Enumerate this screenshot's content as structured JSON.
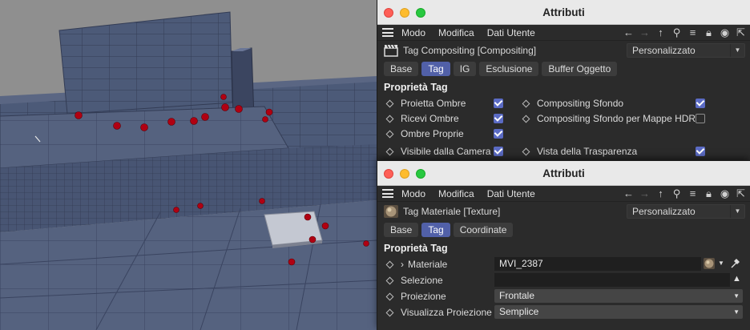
{
  "window1": {
    "title": "Attributi",
    "menu": [
      "Modo",
      "Modifica",
      "Dati Utente"
    ],
    "object_name": "Tag Compositing [Compositing]",
    "preset": "Personalizzato",
    "tabs": [
      "Base",
      "Tag",
      "IG",
      "Esclusione",
      "Buffer Oggetto"
    ],
    "active_tab": "Tag",
    "section": "Proprietà Tag",
    "left_props": [
      {
        "label": "Proietta Ombre",
        "checked": true
      },
      {
        "label": "Ricevi Ombre",
        "checked": true
      },
      {
        "label": "Ombre Proprie",
        "checked": true
      },
      {
        "label": "Visibile dalla Camera",
        "checked": true
      }
    ],
    "right_props": [
      {
        "label": "Compositing Sfondo",
        "checked": true
      },
      {
        "label": "Compositing Sfondo per Mappe HDR",
        "checked": false
      },
      {
        "label": "Vista della Trasparenza",
        "checked": true
      }
    ]
  },
  "window2": {
    "title": "Attributi",
    "menu": [
      "Modo",
      "Modifica",
      "Dati Utente"
    ],
    "object_name": "Tag Materiale [Texture]",
    "preset": "Personalizzato",
    "tabs": [
      "Base",
      "Tag",
      "Coordinate"
    ],
    "active_tab": "Tag",
    "section": "Proprietà Tag",
    "props": {
      "materiale_label": "Materiale",
      "materiale_value": "MVI_2387",
      "selezione_label": "Selezione",
      "selezione_value": "",
      "proiezione_label": "Proiezione",
      "proiezione_value": "Frontale",
      "visualizza_label": "Visualizza Proiezione",
      "visualizza_value": "Semplice"
    }
  },
  "colors": {
    "accent": "#5160a8",
    "checkbox": "#5b6bc4",
    "panel_bg": "#2b2b2b",
    "mesh": "#4c5a78",
    "marker": "#b00010"
  }
}
